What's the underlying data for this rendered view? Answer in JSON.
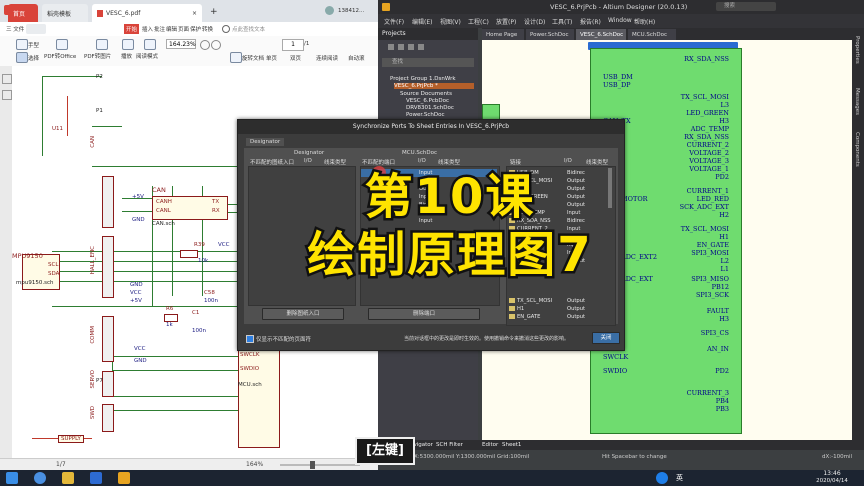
{
  "pdf": {
    "tabs": [
      "首页",
      "稻壳模板",
      "VESC_6.pdf"
    ],
    "tab_close": "×",
    "tab_add": "+",
    "account": "138412...",
    "menu": [
      "三 文件",
      "开始",
      "插入",
      "批注",
      "编辑",
      "页面",
      "保护",
      "转换"
    ],
    "menu_highlight": "开始",
    "search_placeholder": "点此查找文本",
    "tools": [
      "手型",
      "选择",
      "PDF转Office",
      "PDF转图片",
      "播放",
      "阅读模式",
      "旋转文档",
      "单页",
      "双页",
      "连续阅读",
      "自动滚"
    ],
    "zoom": "164.23%",
    "page_current": "1",
    "page_total": "/1",
    "status_page": "1/7",
    "status_zoom": "164%",
    "schematic": {
      "u11": "U11",
      "p2": "P2",
      "p1": "P1",
      "can_label": "CAN",
      "canh": "CANH",
      "canl": "CANL",
      "tx": "TX",
      "rx": "RX",
      "v5": "+5V",
      "gnd": "GND",
      "can_sch": "CAN.sch",
      "hall_enc": "HALL_ENC",
      "r39": "R39",
      "r39_val": "10k",
      "vcc": "VCC",
      "c58": "C58",
      "c58_val": "100n",
      "mpu": "MPU9150",
      "scl": "SCL",
      "sda": "SDA",
      "mpu_sch": "mpu9150.sch",
      "comm": "COMM",
      "servo": "SERVO",
      "r6": "R6",
      "r6_val": "1k",
      "c1": "C1",
      "c1_val": "100n",
      "swd": "SWD",
      "swclk": "SWCLK",
      "swdio": "SWDIO",
      "mcu_sch": "MCU.sch",
      "supply": "SUPPLY",
      "p7": "P7",
      "v3": "VCC"
    }
  },
  "altium": {
    "title": "VESC_6.PrjPcb - Altium Designer (20.0.13)",
    "search": "搜索",
    "menu": [
      "文件(F)",
      "编辑(E)",
      "视图(V)",
      "工程(C)",
      "放置(P)",
      "设计(D)",
      "工具(T)",
      "报告(R)",
      "Window",
      "帮助(H)"
    ],
    "projects_title": "Projects",
    "project_search": "查找",
    "tree": [
      "Project Group 1.DsnWrk",
      "VESC_6.PrjPcb *",
      "Source Documents",
      "VESC_6.PcbDoc",
      "DRV8301.SchDoc",
      "Power.SchDoc"
    ],
    "doc_tabs": [
      "Home Page",
      "Power.SchDoc",
      "VESC_6.SchDoc",
      "MCU.SchDoc"
    ],
    "active_doc_tab": "VESC_6.SchDoc",
    "right_panels": [
      "Properties",
      "Messages",
      "Components"
    ],
    "bottom_tabs": [
      "Editor",
      "Sheet1",
      "Navigator",
      "SCH Filter"
    ],
    "status_left": "X:5300.000mil Y:1300.000mil  Grid:100mil",
    "status_mid": "Hit Spacebar to change",
    "status_right": "dX:-100mil",
    "pins_left": [
      "USB_DM",
      "USB_DP",
      "CAN_TX",
      "MOTOR",
      "ADC_EXT2",
      "ADC_EXT",
      "SWCLK",
      "SWDIO"
    ],
    "pins_right": [
      "RX_SDA_NSS",
      "TX_SCL_MOSI",
      "L3",
      "LED_GREEN",
      "H3",
      "ADC_TEMP",
      "RX_SDA_NSS",
      "CURRENT_2",
      "VOLTAGE_2",
      "VOLTAGE_3",
      "VOLTAGE_1",
      "PD2",
      "CURRENT_1",
      "LED_RED",
      "SCK_ADC_EXT",
      "H2",
      "TX_SCL_MOSI",
      "H1",
      "EN_GATE",
      "SPI3_MOSI",
      "L2",
      "L1",
      "SPI3_MISO",
      "PB12",
      "SPI3_SCK",
      "FAULT",
      "H3",
      "SPI3_CS",
      "AN_IN",
      "PD2",
      "CURRENT_3",
      "PB4",
      "PB3"
    ]
  },
  "dialog": {
    "title": "Synchronize Ports To Sheet Entries In VESC_6.PrjPcb",
    "tab": "Designator",
    "left_header": "Designator",
    "left_cols": [
      "不匹配的图纸入口",
      "I/O",
      "线束类型"
    ],
    "mid_header": "MCU.SchDoc",
    "mid_cols": [
      "不匹配的端口",
      "I/O",
      "线束类型"
    ],
    "mid_rows": [
      {
        "name": "...",
        "io": "Input",
        "sel": true
      },
      {
        "name": "...",
        "io": "Output",
        "sel": false
      },
      {
        "name": "",
        "io": "Output",
        "sel": false
      },
      {
        "name": "",
        "io": "Input",
        "sel": false
      },
      {
        "name": "",
        "io": "Bidirec",
        "sel": false
      },
      {
        "name": "",
        "io": "Input",
        "sel": false
      },
      {
        "name": "",
        "io": "Input",
        "sel": false
      }
    ],
    "right_cols": [
      "链接",
      "I/O",
      "线束类型"
    ],
    "right_rows": [
      {
        "name": "USB_DM",
        "io": "Bidirec"
      },
      {
        "name": "TX_SCL_MOSI",
        "io": "Output"
      },
      {
        "name": "L3",
        "io": "Output"
      },
      {
        "name": "LED_GREEN",
        "io": "Output"
      },
      {
        "name": "H2",
        "io": "Output"
      },
      {
        "name": "ADC_TEMP",
        "io": "Input"
      },
      {
        "name": "RX_SDA_NSS",
        "io": "Bidirec"
      },
      {
        "name": "CURRENT_2",
        "io": "Input"
      },
      {
        "name": "VOLTAGE_2",
        "io": "Input"
      },
      {
        "name": "VOLTAGE_3",
        "io": "Input"
      },
      {
        "name": "VOLTAGE_1",
        "io": "Input"
      },
      {
        "name": "PD2",
        "io": "Output"
      },
      {
        "name": "",
        "io": ""
      },
      {
        "name": "",
        "io": ""
      },
      {
        "name": "",
        "io": ""
      },
      {
        "name": "",
        "io": ""
      },
      {
        "name": "TX_SCL_MOSI",
        "io": "Output"
      },
      {
        "name": "H1",
        "io": "Output"
      },
      {
        "name": "EN_GATE",
        "io": "Output"
      }
    ],
    "btn_delete_entry": "删除图纸入口",
    "btn_delete_port": "删除端口",
    "checkbox_label": "仅显示不匹配的页面符",
    "footer_text": "当前对话框中的更改是即时生效的。使用撤销命令来撤消这些更改的影响。",
    "btn_close": "关闭"
  },
  "overlay": {
    "line1": "第10课",
    "line2": "绘制原理图7"
  },
  "key_badge": "[左键]",
  "taskbar": {
    "time": "13:46",
    "date": "2020/04/14",
    "ime": "英"
  },
  "colors": {
    "overlay_text": "#ffe400",
    "schematic_block": "#6fdc6f",
    "pin_text": "#00008b",
    "altium_bg": "#3c3f41",
    "wps_accent": "#d9443a"
  }
}
